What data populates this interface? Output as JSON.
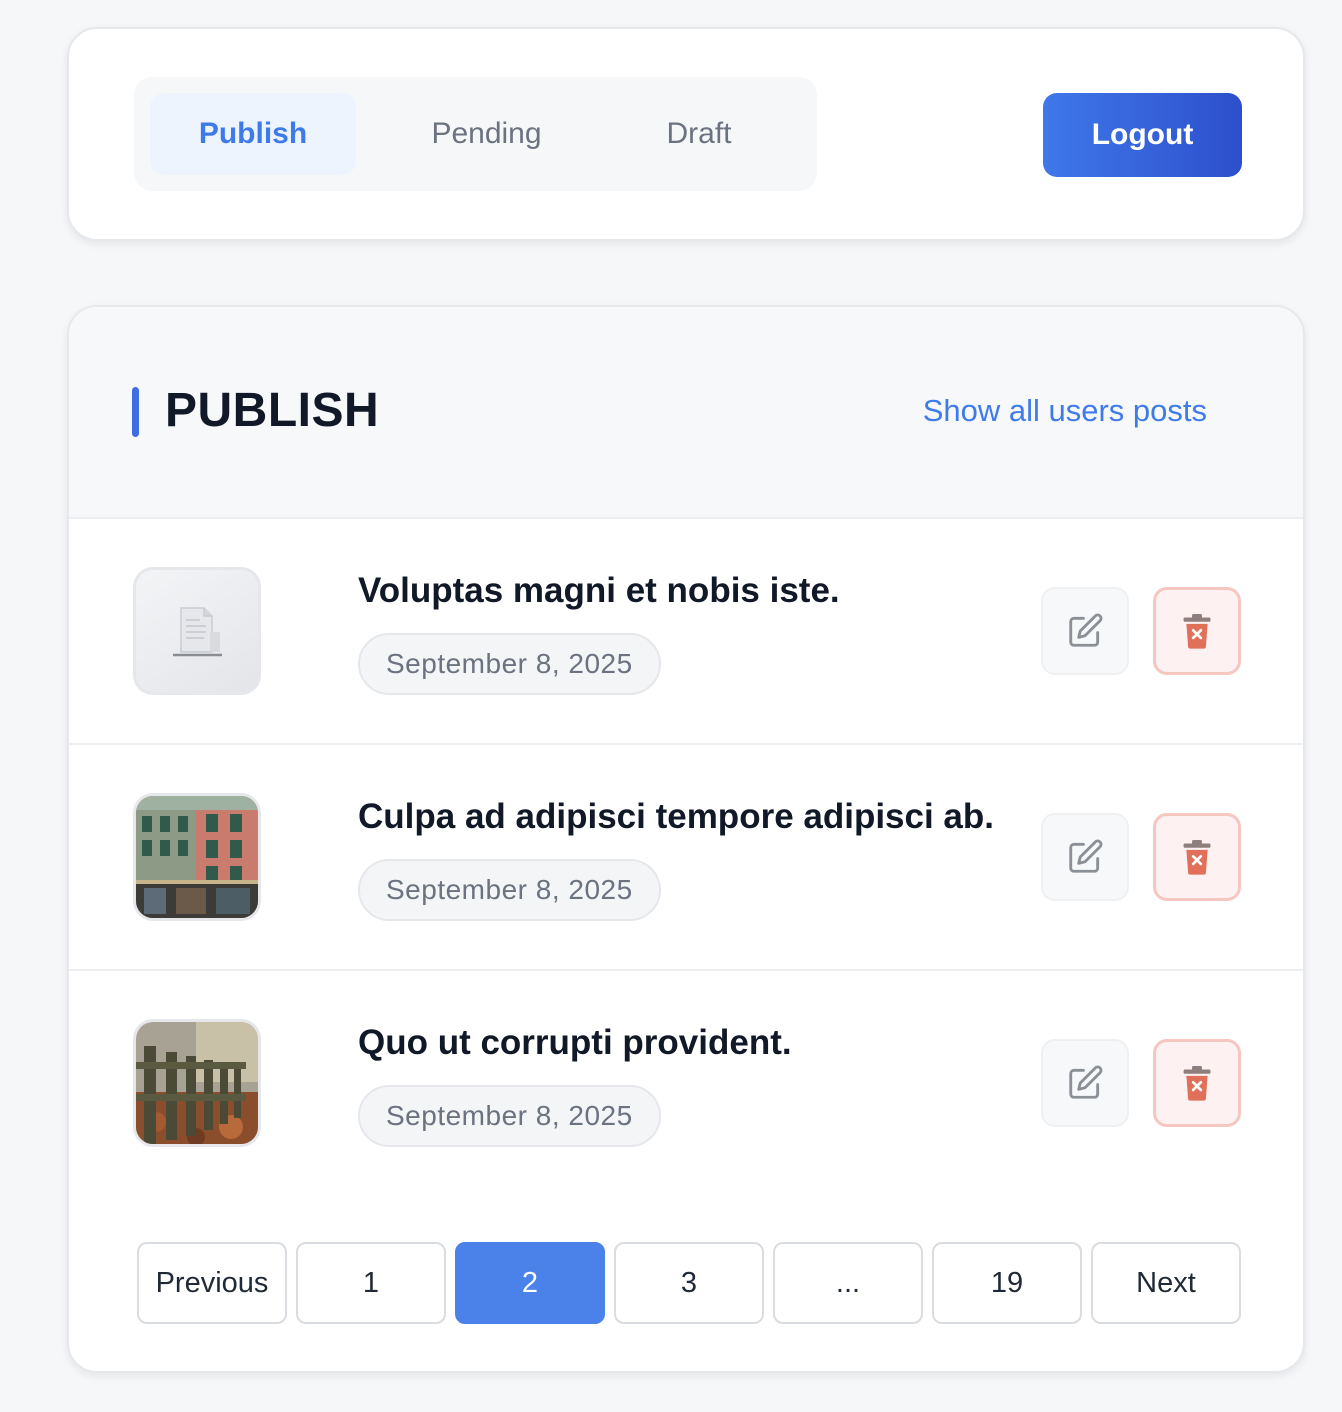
{
  "nav": {
    "tabs": [
      {
        "label": "Publish",
        "active": true
      },
      {
        "label": "Pending",
        "active": false
      },
      {
        "label": "Draft",
        "active": false
      }
    ],
    "logout_label": "Logout"
  },
  "section": {
    "title": "PUBLISH",
    "show_all_label": "Show all users posts"
  },
  "posts": [
    {
      "title": "Voluptas magni et nobis iste.",
      "date": "September 8, 2025",
      "thumbnail": "placeholder-document-icon"
    },
    {
      "title": "Culpa ad adipisci tempore adipisci ab.",
      "date": "September 8, 2025",
      "thumbnail": "building-photo"
    },
    {
      "title": "Quo ut corrupti provident.",
      "date": "September 8, 2025",
      "thumbnail": "fence-autumn-photo"
    }
  ],
  "pagination": {
    "previous_label": "Previous",
    "pages": [
      "1",
      "2",
      "3",
      "...",
      "19"
    ],
    "current_page": "2",
    "next_label": "Next"
  },
  "colors": {
    "accent": "#3f7be8",
    "primary_button": "#2d4fcc",
    "delete_icon": "#e0705a",
    "active_page": "#4b82ea"
  }
}
